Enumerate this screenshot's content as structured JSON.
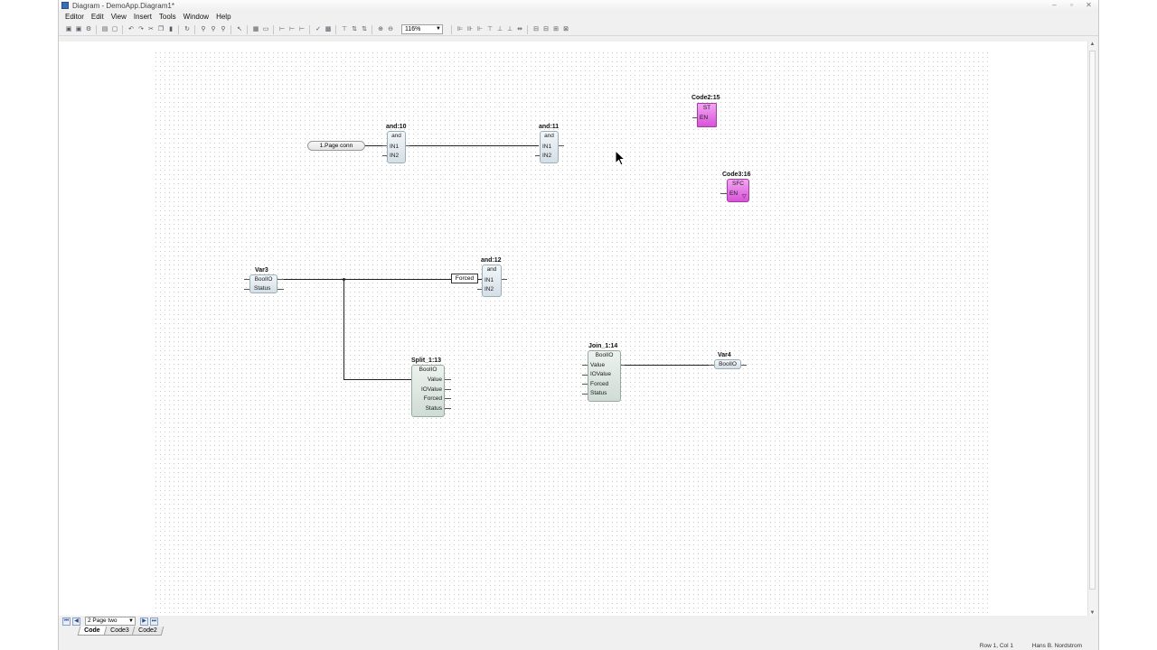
{
  "window": {
    "title": "Diagram - DemoApp.Diagram1*"
  },
  "menu": [
    "Editor",
    "Edit",
    "View",
    "Insert",
    "Tools",
    "Window",
    "Help"
  ],
  "toolbar": {
    "zoom": "116%"
  },
  "diagram": {
    "page_connector": "1.Page conn",
    "forced_tag": "Forced",
    "blocks": {
      "and10": {
        "name": "and:10",
        "type": "and",
        "pins": [
          "IN1",
          "IN2"
        ]
      },
      "and11": {
        "name": "and:11",
        "type": "and",
        "pins": [
          "IN1",
          "IN2"
        ]
      },
      "and12": {
        "name": "and:12",
        "type": "and",
        "pins": [
          "IN1",
          "IN2"
        ]
      },
      "code2": {
        "name": "Code2:15",
        "type": "ST",
        "pin": "EN"
      },
      "code3": {
        "name": "Code3:16",
        "type": "SFC",
        "pin": "EN"
      },
      "var3": {
        "name": "Var3",
        "type": "BoolIO",
        "pin": "Status"
      },
      "split": {
        "name": "Split_1:13",
        "type": "BoolIO",
        "pins": [
          "Value",
          "IOValue",
          "Forced",
          "Status"
        ]
      },
      "join": {
        "name": "Join_1:14",
        "type": "BoolIO",
        "pins": [
          "Value",
          "IOValue",
          "Forced",
          "Status"
        ]
      },
      "var4": {
        "name": "Var4",
        "type": "BoolIO"
      }
    }
  },
  "navigator": {
    "page": "2 Page two"
  },
  "tabs": [
    "Code",
    "Code3",
    "Code2"
  ],
  "status": {
    "position": "Row 1, Col 1",
    "user": "Hans B. Nordstrom"
  }
}
